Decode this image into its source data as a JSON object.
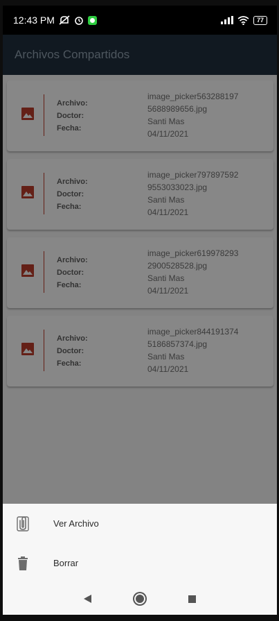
{
  "status_bar": {
    "time": "12:43 PM",
    "battery": "77"
  },
  "app_bar": {
    "title": "Archivos Compartidos"
  },
  "labels": {
    "archivo": "Archivo:",
    "doctor": "Doctor:",
    "fecha": "Fecha:"
  },
  "files": [
    {
      "name_line1": "image_picker563288197",
      "name_line2": "5688989656.jpg",
      "doctor": "Santi Mas",
      "date": "04/11/2021"
    },
    {
      "name_line1": "image_picker797897592",
      "name_line2": "9553033023.jpg",
      "doctor": "Santi Mas",
      "date": "04/11/2021"
    },
    {
      "name_line1": "image_picker619978293",
      "name_line2": "2900528528.jpg",
      "doctor": "Santi Mas",
      "date": "04/11/2021"
    },
    {
      "name_line1": "image_picker844191374",
      "name_line2": "5186857374.jpg",
      "doctor": "Santi Mas",
      "date": "04/11/2021"
    }
  ],
  "sheet": {
    "items": [
      {
        "label": "Ver Archivo",
        "icon": "attachment-icon"
      },
      {
        "label": "Borrar",
        "icon": "trash-icon"
      }
    ]
  },
  "colors": {
    "accent": "#b33a2a",
    "app_bar": "#1f2d3b"
  }
}
